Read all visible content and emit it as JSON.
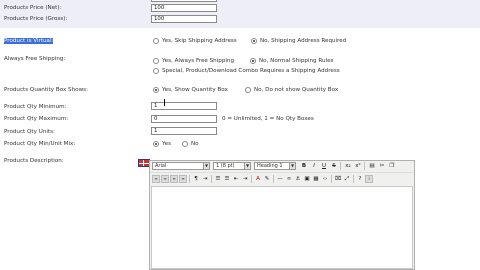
{
  "rows": {
    "price_net": {
      "label": "Products Price (Net):",
      "value": "100"
    },
    "price_gross": {
      "label": "Products Price (Gross):",
      "value": "100"
    },
    "virtual": {
      "label_selected": "Product is Virtual:",
      "opt_yes": "Yes, Skip Shipping Address",
      "opt_no": "No, Shipping Address Required"
    },
    "free_shipping": {
      "label": "Always Free Shipping:",
      "opt_yes": "Yes, Always Free Shipping",
      "opt_no": "No, Normal Shipping Rules",
      "opt_special": "Special, Product/Download Combo Requires a Shipping Address"
    },
    "qty_box": {
      "label": "Products Quantity Box Shows:",
      "opt_yes": "Yes, Show Quantity Box",
      "opt_no": "No, Do not show Quantity Box"
    },
    "qty_min": {
      "label": "Product Qty Minimum:",
      "value": "1"
    },
    "qty_max": {
      "label": "Product Qty Maximum:",
      "value": "0",
      "hint": "0 = Unlimited, 1 = No Qty Boxes"
    },
    "qty_units": {
      "label": "Product Qty Units:",
      "value": "1"
    },
    "qty_mixed": {
      "label": "Product Qty Min/Unit Mix:",
      "opt_yes": "Yes",
      "opt_no": "No"
    },
    "description": {
      "label": "Products Description:"
    }
  },
  "editor": {
    "font_select": "Arial",
    "size_select": "1 (8 pt)",
    "format_select": "Heading 1",
    "bold": "B",
    "italic": "I",
    "underline": "U",
    "strike": "S",
    "sub": "x₂",
    "sup": "x²",
    "cut": "✂",
    "help": "?",
    "info": "i"
  },
  "colors": {
    "band": "#eeeef9",
    "selection": "#3a6fd8"
  }
}
